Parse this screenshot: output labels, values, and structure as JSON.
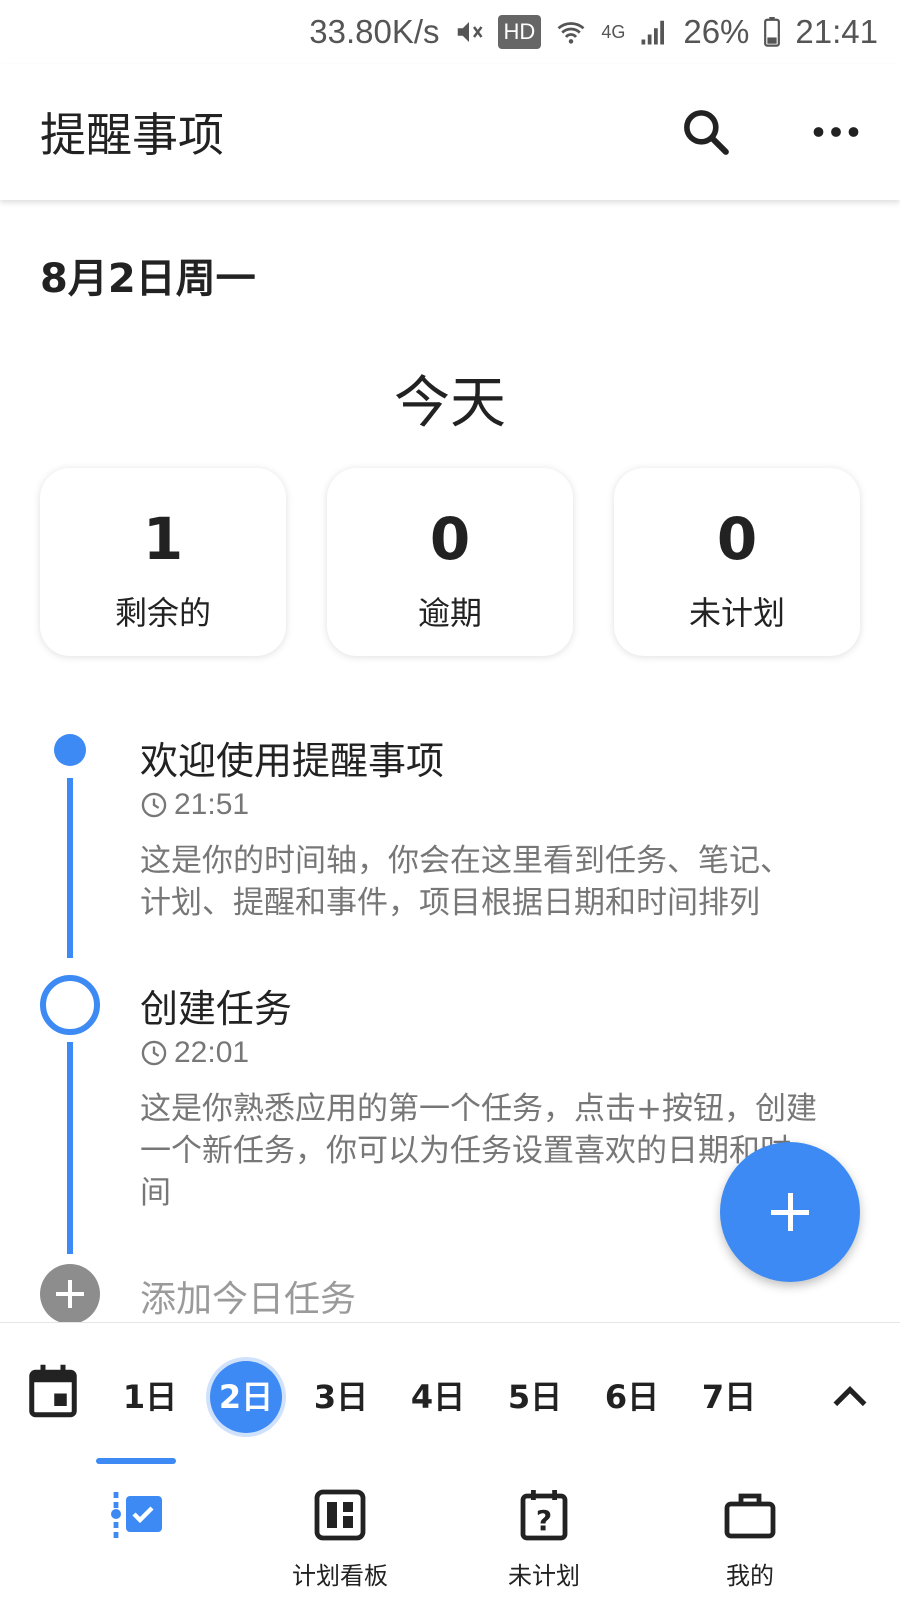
{
  "status_bar": {
    "speed": "33.80K/s",
    "hd": "HD",
    "network": "4G",
    "battery": "26%",
    "time": "21:41"
  },
  "app_bar": {
    "title": "提醒事项"
  },
  "date_label": "8月2日周一",
  "today_label": "今天",
  "stats": [
    {
      "value": "1",
      "label": "剩余的"
    },
    {
      "value": "0",
      "label": "逾期"
    },
    {
      "value": "0",
      "label": "未计划"
    }
  ],
  "timeline": [
    {
      "title": "欢迎使用提醒事项",
      "time": "21:51",
      "desc_line1": "这是你的时间轴，你会在这里看到任务、笔记、",
      "desc_line2": "计划、提醒和事件，项目根据日期和时间排列",
      "desc_line3": ""
    },
    {
      "title": "创建任务",
      "time": "22:01",
      "desc_line1": "这是你熟悉应用的第一个任务，点击+按钮，创建",
      "desc_line2": "一个新任务，你可以为任务设置喜欢的日期和时",
      "desc_line3": "间"
    }
  ],
  "add_task_placeholder": "添加今日任务",
  "day_strip": {
    "days": [
      "1日",
      "2日",
      "3日",
      "4日",
      "5日",
      "6日",
      "7日"
    ],
    "selected": "2日"
  },
  "bottom_nav": {
    "items": [
      "",
      "计划看板",
      "未计划",
      "我的"
    ]
  },
  "colors": {
    "accent": "#3d8af5",
    "muted": "#777777"
  }
}
